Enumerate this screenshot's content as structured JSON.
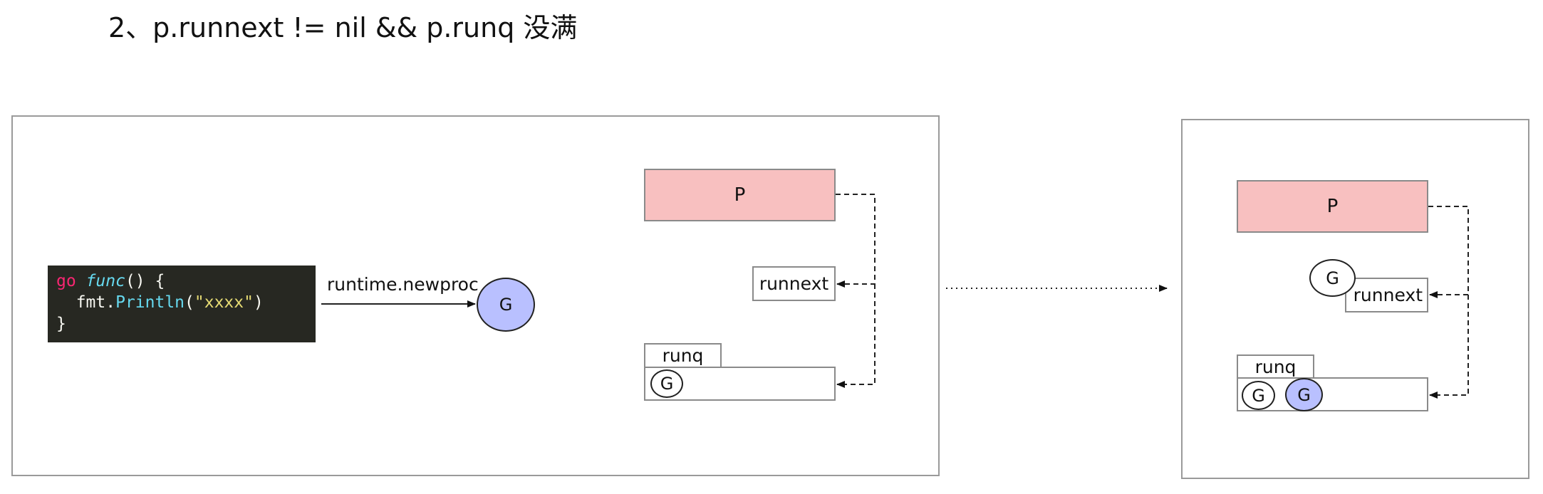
{
  "title": "2、p.runnext != nil && p.runq 没满",
  "code": {
    "kw_go": "go",
    "kw_func": "func",
    "sig_rest": "() {",
    "line2_pkg": "  fmt.",
    "line2_call": "Println",
    "line2_open": "(",
    "line2_str": "\"xxxx\"",
    "line2_close": ")",
    "line3": "}"
  },
  "left_panel": {
    "call_label": "runtime.newproc",
    "new_goroutine": "G",
    "p_label": "P",
    "runnext_label": "runnext",
    "runq_label": "runq",
    "runq_items": [
      "G"
    ]
  },
  "right_panel": {
    "p_label": "P",
    "runnext_label": "runnext",
    "runnext_goroutine": "G",
    "runq_label": "runq",
    "runq_items": [
      "G",
      "G"
    ]
  },
  "colors": {
    "p_fill": "#f8c0c0",
    "new_g_fill": "#b9c0ff",
    "code_bg": "#272822"
  }
}
